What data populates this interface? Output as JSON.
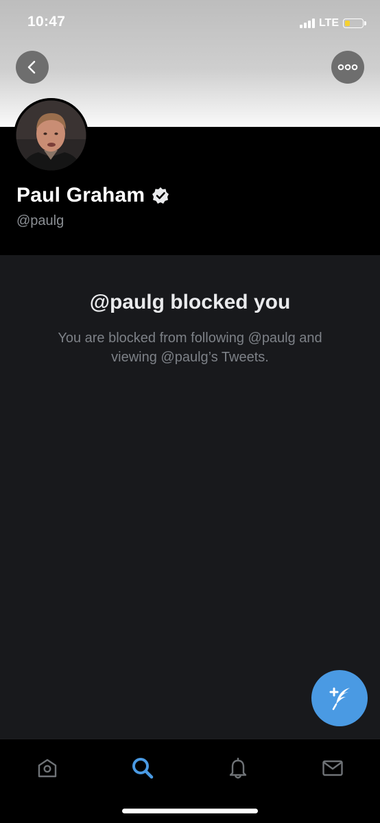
{
  "status_bar": {
    "time": "10:47",
    "network": "LTE",
    "signal_bars": 4,
    "battery_level": 0.3,
    "battery_color": "#f6d130"
  },
  "header": {
    "back_icon": "chevron-left-icon",
    "more_icon": "more-horizontal-icon"
  },
  "profile": {
    "name": "Paul Graham",
    "handle": "@paulg",
    "verified": true,
    "avatar_icon": "profile-photo"
  },
  "blocked": {
    "title": "@paulg blocked you",
    "message": "You are blocked from following @paulg and viewing @paulg’s Tweets."
  },
  "compose": {
    "icon": "compose-tweet-icon",
    "color": "#4a9ae3"
  },
  "tab_bar": {
    "active": "search",
    "active_color": "#4a9ae3",
    "inactive_color": "#6f7377",
    "tabs": [
      {
        "id": "home",
        "icon": "home-icon"
      },
      {
        "id": "search",
        "icon": "search-icon"
      },
      {
        "id": "notifications",
        "icon": "bell-icon"
      },
      {
        "id": "messages",
        "icon": "mail-icon"
      }
    ]
  }
}
